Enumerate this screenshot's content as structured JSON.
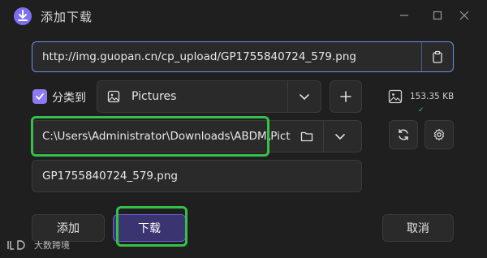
{
  "window": {
    "title": "添加下载",
    "logo_icon": "download-app-logo",
    "controls": [
      "minimize-icon",
      "maximize-icon",
      "close-icon"
    ]
  },
  "url": {
    "value": "http://img.guopan.cn/cp_upload/GP1755840724_579.png",
    "paste_icon": "clipboard-icon"
  },
  "category": {
    "checkbox_checked": true,
    "checkbox_label": "分类到",
    "selected": "Pictures",
    "category_icon": "image-icon",
    "add_icon": "plus-icon"
  },
  "file_info": {
    "icon": "image-icon",
    "size": "153.35 KB",
    "status_mark": "✓"
  },
  "path": {
    "value": "C:\\Users\\Administrator\\Downloads\\ABDM\\Pictures",
    "folder_icon": "folder-icon",
    "refresh_icon": "refresh-icon",
    "settings_icon": "gear-icon"
  },
  "filename": {
    "value": "GP1755840724_579.png"
  },
  "buttons": {
    "add": "添加",
    "download": "下载",
    "cancel": "取消"
  },
  "watermark": {
    "logo": "lD",
    "text": "大数跨境"
  },
  "colors": {
    "accent": "#8a7cf0",
    "highlight": "#35c04a",
    "background": "#1f1f1f",
    "primary_button": "#3a3470"
  }
}
